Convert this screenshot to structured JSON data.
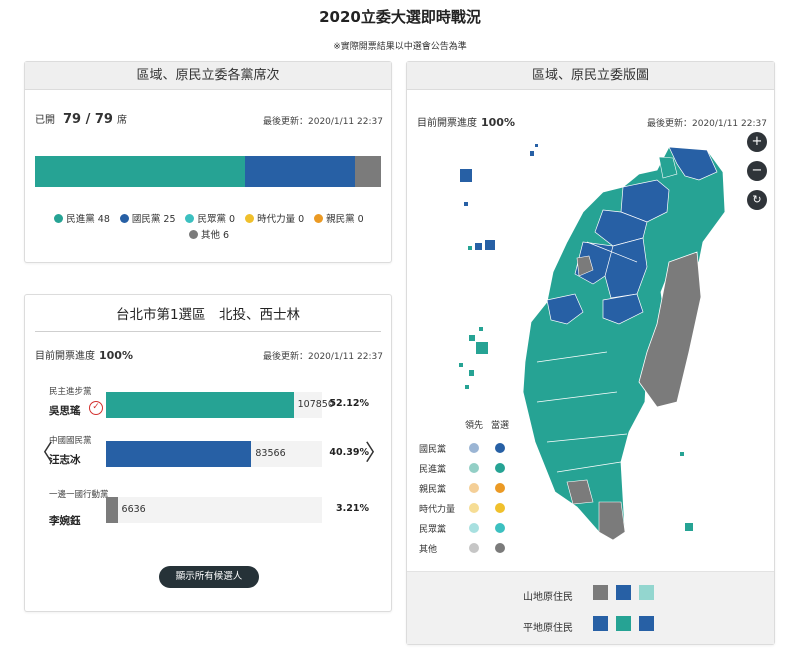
{
  "page": {
    "title": "2020立委大選即時戰況",
    "disclaimer": "※實際開票結果以中選會公告為準"
  },
  "seats": {
    "header": "區域、原民立委各黨席次",
    "opened_label": "已開",
    "opened_value": "79 / 79",
    "seat_unit": "席",
    "updated": "最後更新：2020/1/11 22:37",
    "total": 79,
    "parties": [
      {
        "name": "民進黨",
        "seats": 48,
        "color": "#26a394",
        "label": "民進黨 48"
      },
      {
        "name": "國民黨",
        "seats": 25,
        "color": "#2760a5",
        "label": "國民黨 25"
      },
      {
        "name": "民眾黨",
        "seats": 0,
        "color": "#3cc0c0",
        "label": "民眾黨 0"
      },
      {
        "name": "時代力量",
        "seats": 0,
        "color": "#f0c02c",
        "label": "時代力量 0"
      },
      {
        "name": "親民黨",
        "seats": 0,
        "color": "#eb9a24",
        "label": "親民黨 0"
      },
      {
        "name": "其他",
        "seats": 6,
        "color": "#7b7b7b",
        "label": "其他 6"
      }
    ]
  },
  "district": {
    "title": "台北市第1選區　北投、西士林",
    "progress_label": "目前開票進度",
    "progress_value": "100%",
    "updated": "最後更新：2020/1/11 22:37",
    "elected_symbol": "✓",
    "prev_symbol": "〈",
    "next_symbol": "〉",
    "show_all_label": "顯示所有候選人",
    "candidates": [
      {
        "party": "民主進步黨",
        "name": "吳思瑤",
        "votes": "107850",
        "pct": "52.12%",
        "share": 0.5212,
        "color": "#26a394",
        "elected": true
      },
      {
        "party": "中國國民黨",
        "name": "汪志冰",
        "votes": "83566",
        "pct": "40.39%",
        "share": 0.4039,
        "color": "#2760a5",
        "elected": false
      },
      {
        "party": "一邊一國行動黨",
        "name": "李婉鈺",
        "votes": "6636",
        "pct": "3.21%",
        "share": 0.0321,
        "color": "#7b7b7b",
        "elected": false
      }
    ]
  },
  "map": {
    "header": "區域、原民立委版圖",
    "progress_label": "目前開票進度",
    "progress_value": "100%",
    "updated": "最後更新：2020/1/11 22:37",
    "zoom_in": "+",
    "zoom_out": "−",
    "reset": "↻",
    "legend": {
      "col_leading": "領先",
      "col_elected": "當選",
      "rows": [
        {
          "label": "國民黨",
          "leading": "#9bb5d4",
          "elected": "#2760a5"
        },
        {
          "label": "民進黨",
          "leading": "#93cfc6",
          "elected": "#26a394"
        },
        {
          "label": "親民黨",
          "leading": "#f4cf97",
          "elected": "#eb9a24"
        },
        {
          "label": "時代力量",
          "leading": "#f6dd95",
          "elected": "#f0c02c"
        },
        {
          "label": "民眾黨",
          "leading": "#a8e0e0",
          "elected": "#3cc0c0"
        },
        {
          "label": "其他",
          "leading": "#c6c6c6",
          "elected": "#7b7b7b"
        }
      ]
    },
    "aboriginal": [
      {
        "label": "山地原住民",
        "colors": [
          "#7b7b7b",
          "#2760a5",
          "#93d6cf"
        ]
      },
      {
        "label": "平地原住民",
        "colors": [
          "#2760a5",
          "#26a394",
          "#2760a5"
        ]
      }
    ]
  }
}
